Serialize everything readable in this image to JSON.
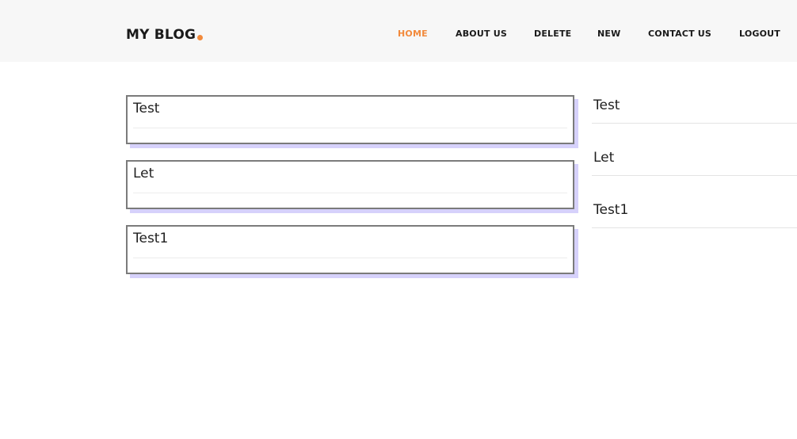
{
  "brand": {
    "title": "MY BLOG"
  },
  "nav": {
    "items": [
      {
        "label": "HOME",
        "active": true
      },
      {
        "label": "ABOUT US",
        "active": false
      },
      {
        "label": "DELETE",
        "active": false
      },
      {
        "label": "NEW",
        "active": false
      },
      {
        "label": "CONTACT US",
        "active": false
      },
      {
        "label": "LOGOUT",
        "active": false
      }
    ]
  },
  "posts": [
    {
      "title": "Test"
    },
    {
      "title": "Let"
    },
    {
      "title": "Test1"
    }
  ],
  "sidebar": {
    "items": [
      {
        "label": "Test"
      },
      {
        "label": "Let"
      },
      {
        "label": "Test1"
      }
    ]
  },
  "colors": {
    "accent": "#f28a3c",
    "header_bg": "#f7f7f7",
    "card_shadow": "#d6d1fb",
    "card_border": "#7b7b7b"
  }
}
